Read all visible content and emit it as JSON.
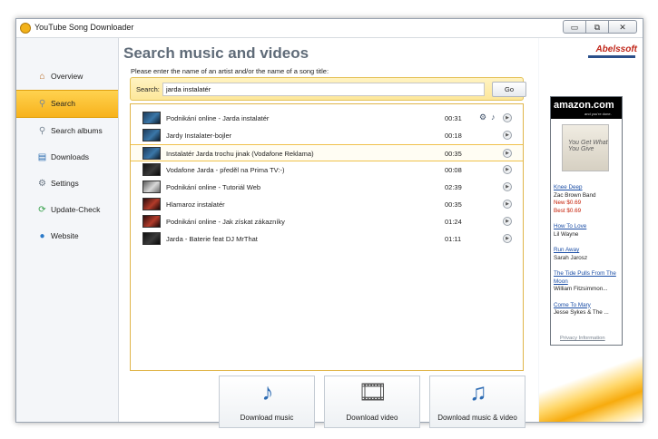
{
  "window": {
    "title": "YouTube Song Downloader",
    "controls": {
      "minimize": "▭",
      "restore": "⧉",
      "close": "✕"
    }
  },
  "sidebar": {
    "items": [
      {
        "label": "Overview",
        "icon": "house-icon",
        "glyph": "⌂",
        "active": false
      },
      {
        "label": "Search",
        "icon": "magnifier-icon",
        "glyph": "⚲",
        "active": true
      },
      {
        "label": "Search albums",
        "icon": "magnifier-icon",
        "glyph": "⚲",
        "active": false
      },
      {
        "label": "Downloads",
        "icon": "disk-icon",
        "glyph": "▤",
        "active": false
      },
      {
        "label": "Settings",
        "icon": "gear-icon",
        "glyph": "⚙",
        "active": false
      },
      {
        "label": "Update-Check",
        "icon": "update-icon",
        "glyph": "⟳",
        "active": false
      },
      {
        "label": "Website",
        "icon": "globe-icon",
        "glyph": "●",
        "active": false
      }
    ]
  },
  "main": {
    "heading": "Search music and videos",
    "prompt": "Please enter the name of an artist and/or the name of a song title:",
    "search": {
      "label": "Search:",
      "value": "jarda instalatér",
      "go_label": "Go"
    },
    "results": [
      {
        "title": "Podnikání online - Jarda instalatér",
        "duration": "00:31",
        "thumb": "blue"
      },
      {
        "title": "Jardy Instalater-bojler",
        "duration": "00:18",
        "thumb": "blue"
      },
      {
        "title": "Instalatér Jarda trochu jinak (Vodafone Reklama)",
        "duration": "00:35",
        "thumb": "blue"
      },
      {
        "title": "Vodafone Jarda - předěl na Prima TV:-)",
        "duration": "00:08",
        "thumb": "dark"
      },
      {
        "title": "Podnikání online - Tutoriál Web",
        "duration": "02:39",
        "thumb": "grey"
      },
      {
        "title": "Hlamaroz instalatér",
        "duration": "00:35",
        "thumb": "red"
      },
      {
        "title": "Podnikání online - Jak získat zákazníky",
        "duration": "01:24",
        "thumb": "red"
      },
      {
        "title": "Jarda - Baterie feat DJ MrThat",
        "duration": "01:11",
        "thumb": "dark"
      }
    ],
    "row_icons": {
      "video": "film-reel-icon",
      "music": "music-note-icon",
      "play": "play-icon"
    },
    "actions": [
      {
        "label": "Download music",
        "icon": "music-note-icon",
        "glyph": "♪"
      },
      {
        "label": "Download video",
        "icon": "film-reel-icon",
        "glyph": "🎞"
      },
      {
        "label": "Download music & video",
        "icon": "music-video-icon",
        "glyph": "♫"
      }
    ]
  },
  "ad_panel": {
    "brand": "Abelssoft",
    "amazon": {
      "logo": "amazon.com",
      "tagline": "and you're done."
    },
    "cover_text": "You Get What You Give",
    "items": [
      {
        "title": "Knee Deep",
        "artist": "Zac Brown Band",
        "new_price": "New $0.69",
        "best_price": "Best $0.69"
      },
      {
        "title": "How To Love",
        "artist": "Lil Wayne"
      },
      {
        "title": "Run Away",
        "artist": "Sarah Jarosz"
      },
      {
        "title": "The Tide Pulls From The Moon",
        "artist": "William Fitzsimmon..."
      },
      {
        "title": "Come To Mary",
        "artist": "Jesse Sykes & The ..."
      }
    ],
    "privacy": "Privacy Information"
  },
  "colors": {
    "accent": "#f7b21b",
    "heading": "#5f6b78",
    "link": "#1b4ea6",
    "price": "#c41a00"
  }
}
